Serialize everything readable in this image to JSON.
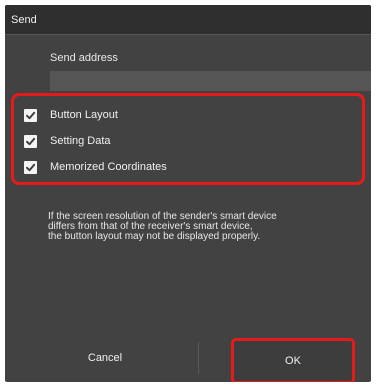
{
  "dialog": {
    "title": "Send",
    "send_address_label": "Send address",
    "send_address_value": "",
    "options": [
      {
        "label": "Button Layout",
        "checked": true
      },
      {
        "label": "Setting Data",
        "checked": true
      },
      {
        "label": "Memorized Coordinates",
        "checked": true
      }
    ],
    "notice_lines": [
      "If the screen resolution of the sender's smart device",
      "differs from that of the receiver's smart device,",
      "the button layout may not be displayed properly."
    ],
    "cancel_label": "Cancel",
    "ok_label": "OK",
    "colors": {
      "dialog_bg": "#424242",
      "title_bg": "#2f2f2f",
      "highlight": "#e51b1b"
    },
    "icons": [
      "checkmark-icon"
    ]
  }
}
